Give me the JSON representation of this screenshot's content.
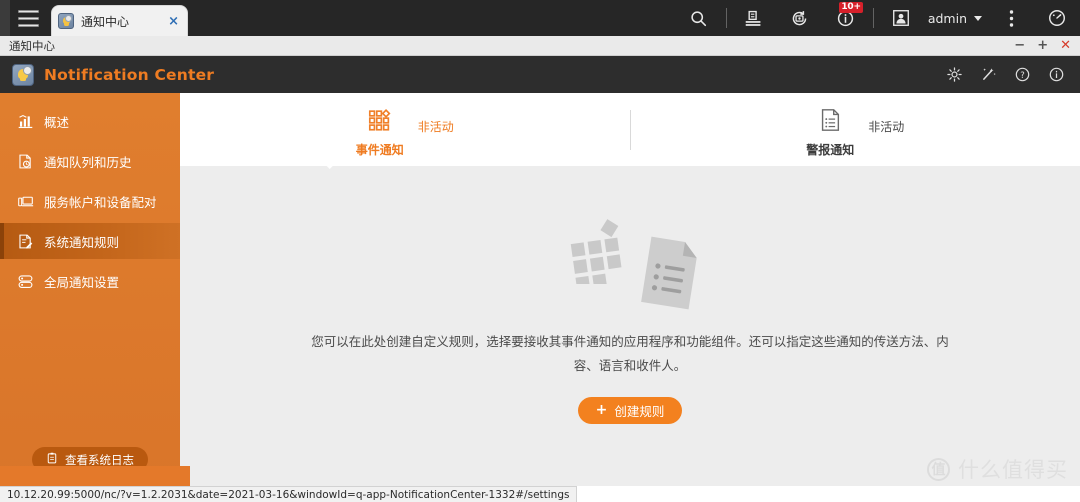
{
  "browser": {
    "menu_icon": "hamburger-icon",
    "tab": {
      "title": "通知中心",
      "favicon": "bell-gear-icon",
      "close": "×"
    },
    "toolbar": {
      "search_icon": "search-icon",
      "filestation_icon": "file-station-icon",
      "backup_icon": "backup-sync-icon",
      "info_icon": "info-icon",
      "info_badge": "10+",
      "user_icon": "user-avatar-icon",
      "user_name": "admin",
      "more_icon": "vertical-dots-icon",
      "dashboard_icon": "dashboard-gauge-icon"
    }
  },
  "window": {
    "title": "通知中心",
    "minimize": "−",
    "maximize": "+",
    "close": "✕"
  },
  "app": {
    "title": "Notification Center",
    "logo": "notification-center-logo",
    "header_icons": [
      "gear-icon",
      "wand-icon",
      "help-icon",
      "info-icon"
    ]
  },
  "sidebar": {
    "items": [
      {
        "label": "概述",
        "icon": "chart-bar-icon",
        "active": false
      },
      {
        "label": "通知队列和历史",
        "icon": "history-document-icon",
        "active": false
      },
      {
        "label": "服务帐户和设备配对",
        "icon": "devices-icon",
        "active": false
      },
      {
        "label": "系统通知规则",
        "icon": "rules-edit-icon",
        "active": true
      },
      {
        "label": "全局通知设置",
        "icon": "server-stack-icon",
        "active": false
      }
    ],
    "system_log_button": "查看系统日志",
    "system_log_icon": "clipboard-icon"
  },
  "tabs": [
    {
      "name": "事件通知",
      "status": "非活动",
      "icon": "event-grid-icon",
      "selected": true
    },
    {
      "name": "警报通知",
      "status": "非活动",
      "icon": "alert-document-icon",
      "selected": false
    }
  ],
  "main": {
    "illustration": "empty-rules-illustration",
    "description": "您可以在此处创建自定义规则，选择要接收其事件通知的应用程序和功能组件。还可以指定这些通知的传送方法、内容、语言和收件人。",
    "create_button": "创建规则",
    "create_icon": "plus-icon"
  },
  "status_bar": {
    "url": "10.12.20.99:5000/nc/?v=1.2.2031&date=2021-03-16&windowId=q-app-NotificationCenter-1332#/settings"
  },
  "watermark": {
    "mark": "值",
    "text": "什么值得买"
  },
  "colors": {
    "brand_orange": "#ef7c22",
    "sidebar_orange": "#e0792a",
    "sidebar_active": "#b55a12",
    "badge_red": "#d6202a",
    "chrome_dark": "#262626"
  }
}
